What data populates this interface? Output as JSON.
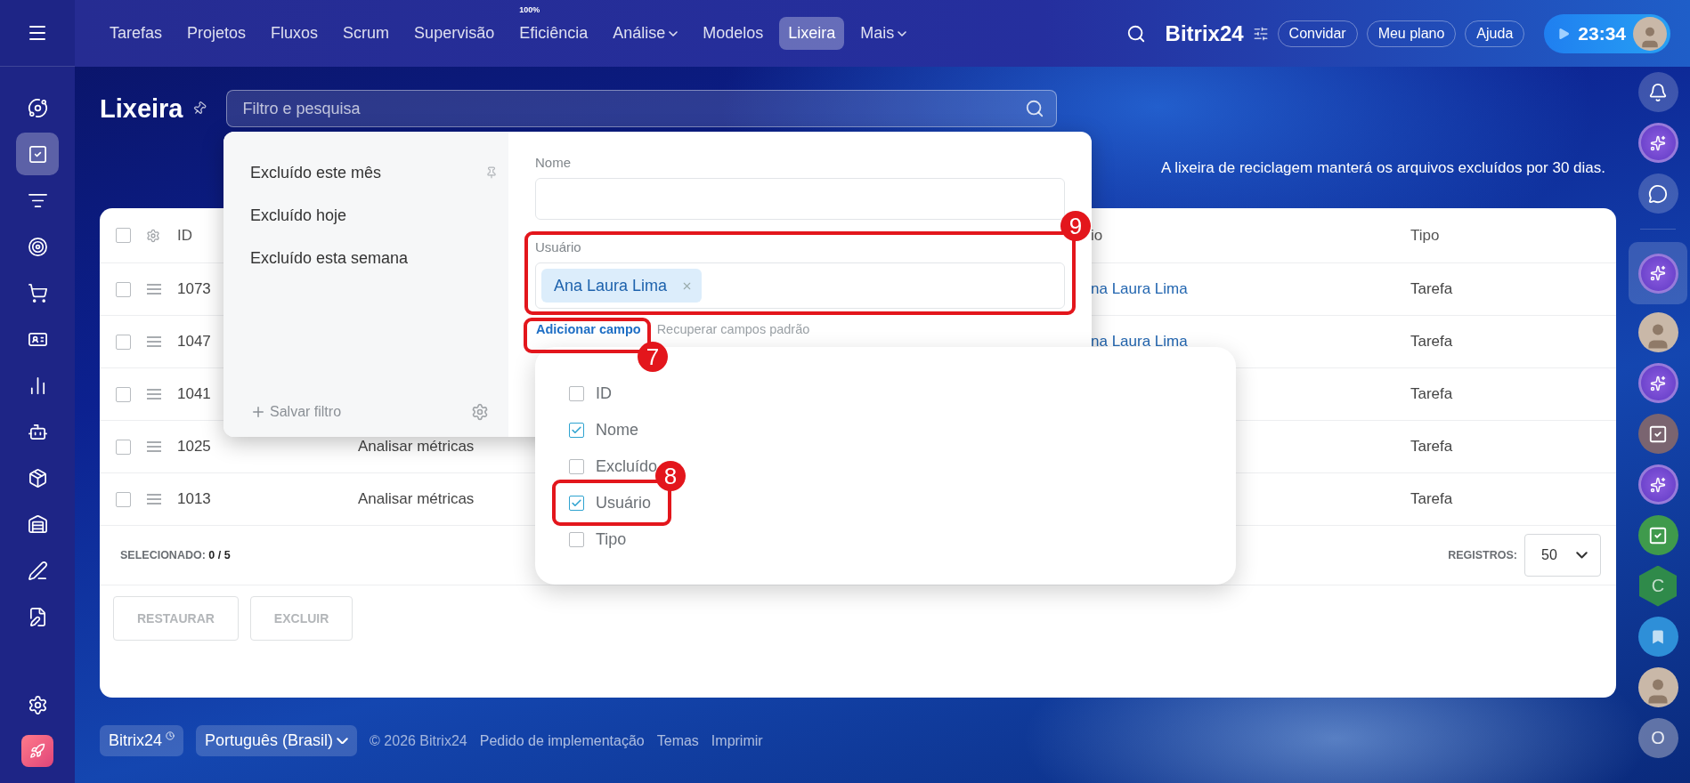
{
  "left_rail": {
    "items": [
      {
        "kind": "crm",
        "selected": false
      },
      {
        "kind": "tasks",
        "selected": true
      },
      {
        "kind": "funnel",
        "selected": false
      },
      {
        "kind": "target",
        "selected": false
      },
      {
        "kind": "shop",
        "selected": false
      },
      {
        "kind": "card",
        "selected": false
      },
      {
        "kind": "analytics",
        "selected": false
      },
      {
        "kind": "bot",
        "selected": false
      },
      {
        "kind": "catalog",
        "selected": false
      },
      {
        "kind": "inventory",
        "selected": false
      },
      {
        "kind": "sign",
        "selected": false
      },
      {
        "kind": "docs",
        "selected": false
      }
    ],
    "bottom": [
      {
        "kind": "settings",
        "selected": false
      },
      {
        "kind": "rocket",
        "selected": false
      }
    ]
  },
  "top_nav": {
    "items": [
      {
        "label": "Tarefas",
        "selected": false,
        "dropdown": false
      },
      {
        "label": "Projetos",
        "selected": false,
        "dropdown": false
      },
      {
        "label": "Fluxos",
        "selected": false,
        "dropdown": false
      },
      {
        "label": "Scrum",
        "selected": false,
        "dropdown": false
      },
      {
        "label": "Supervisão",
        "selected": false,
        "dropdown": false
      },
      {
        "label": "Eficiência",
        "selected": false,
        "dropdown": false,
        "badge": "100%"
      },
      {
        "label": "Análise",
        "selected": false,
        "dropdown": true
      },
      {
        "label": "Modelos",
        "selected": false,
        "dropdown": false
      },
      {
        "label": "Lixeira",
        "selected": true,
        "dropdown": false
      },
      {
        "label": "Mais",
        "selected": false,
        "dropdown": true
      }
    ]
  },
  "header_right": {
    "brand": "Bitrix24",
    "buttons": [
      "Convidar",
      "Meu plano",
      "Ajuda"
    ],
    "timer": "23:34"
  },
  "page": {
    "title": "Lixeira",
    "search": {
      "placeholder": "Filtro e pesquisa"
    },
    "notice": "A lixeira de reciclagem manterá os arquivos excluídos por 30 dias."
  },
  "table": {
    "all_checked": false,
    "header": {
      "id": "ID",
      "column_4": "io",
      "type": "Tipo"
    },
    "rows": [
      {
        "checked": false,
        "id": "1073",
        "column_4": "na Laura Lima",
        "type": "Tarefa"
      },
      {
        "checked": false,
        "id": "1047",
        "column_4": "na Laura Lima",
        "type": "Tarefa"
      },
      {
        "checked": false,
        "id": "1041",
        "type": "Tarefa"
      },
      {
        "checked": false,
        "id": "1025",
        "name": "Analisar métricas",
        "type": "Tarefa"
      },
      {
        "checked": false,
        "id": "1013",
        "name": "Analisar métricas",
        "type": "Tarefa"
      }
    ],
    "selected_label": "SELECIONADO:",
    "selected_count": "0 / 5",
    "records_label": "REGISTROS:",
    "page_size": "50",
    "actions": [
      {
        "label": "RESTAURAR",
        "disabled": true
      },
      {
        "label": "EXCLUIR",
        "disabled": true
      }
    ]
  },
  "filter_popup": {
    "presets": [
      {
        "label": "Excluído este mês",
        "pinned": true
      },
      {
        "label": "Excluído hoje",
        "pinned": false
      },
      {
        "label": "Excluído esta semana",
        "pinned": false
      }
    ],
    "save_filter": "Salvar filtro",
    "fields": [
      {
        "kind": "text",
        "label": "Nome"
      },
      {
        "kind": "user",
        "label": "Usuário",
        "tags": [
          "Ana Laura Lima"
        ]
      }
    ],
    "add_field": "Adicionar campo",
    "restore_fields": "Recuperar campos padrão"
  },
  "field_menu": {
    "items": [
      {
        "label": "ID",
        "checked": false
      },
      {
        "label": "Nome",
        "checked": true
      },
      {
        "label": "Excluído",
        "checked": false
      },
      {
        "label": "Usuário",
        "checked": true
      },
      {
        "label": "Tipo",
        "checked": false
      }
    ]
  },
  "callouts": [
    {
      "number": "9"
    },
    {
      "number": "7"
    },
    {
      "number": "8"
    }
  ],
  "right_rail": {
    "top": [
      {
        "kind": "bell",
        "selected": false
      },
      {
        "kind": "copilot",
        "selected": false
      },
      {
        "kind": "chat",
        "selected": false
      }
    ],
    "items": [
      {
        "kind": "copilot",
        "selected": true
      },
      {
        "kind": "avatar",
        "selected": false
      },
      {
        "kind": "copilot",
        "selected": false
      },
      {
        "kind": "task",
        "selected": false,
        "color": "#7a6470"
      },
      {
        "kind": "copilot",
        "selected": false
      },
      {
        "kind": "task",
        "selected": false,
        "color": "#3f9a4c"
      },
      {
        "kind": "hex",
        "selected": false,
        "letter": "C"
      },
      {
        "kind": "bookmark",
        "selected": false
      },
      {
        "kind": "avatar",
        "selected": false
      },
      {
        "kind": "letter",
        "selected": false,
        "letter": "O"
      }
    ]
  },
  "footer": {
    "brand": "Bitrix24",
    "language": "Português (Brasil)",
    "copyright": "© 2026 Bitrix24",
    "links": [
      "Pedido de implementação",
      "Temas",
      "Imprimir"
    ]
  }
}
